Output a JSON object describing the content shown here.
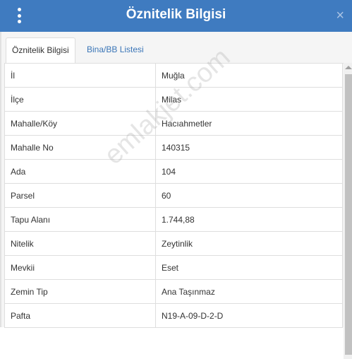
{
  "header": {
    "title": "Öznitelik Bilgisi",
    "menu_icon": "kebab-menu-icon",
    "close_icon": "close-icon",
    "close_glyph": "×"
  },
  "tabs": [
    {
      "label": "Öznitelik Bilgisi",
      "active": true
    },
    {
      "label": "Bina/BB Listesi",
      "active": false
    }
  ],
  "rows": [
    {
      "key": "İl",
      "value": "Muğla"
    },
    {
      "key": "İlçe",
      "value": "Milas"
    },
    {
      "key": "Mahalle/Köy",
      "value": "Hacıahmetler"
    },
    {
      "key": "Mahalle No",
      "value": "140315"
    },
    {
      "key": "Ada",
      "value": "104"
    },
    {
      "key": "Parsel",
      "value": "60"
    },
    {
      "key": "Tapu Alanı",
      "value": "1.744,88"
    },
    {
      "key": "Nitelik",
      "value": "Zeytinlik"
    },
    {
      "key": "Mevkii",
      "value": "Eset"
    },
    {
      "key": "Zemin Tip",
      "value": "Ana Taşınmaz"
    },
    {
      "key": "Pafta",
      "value": "N19-A-09-D-2-D"
    }
  ],
  "watermark": "emlakjet.com",
  "colors": {
    "header": "#3f7bc0",
    "tab_link": "#3a75b7"
  }
}
